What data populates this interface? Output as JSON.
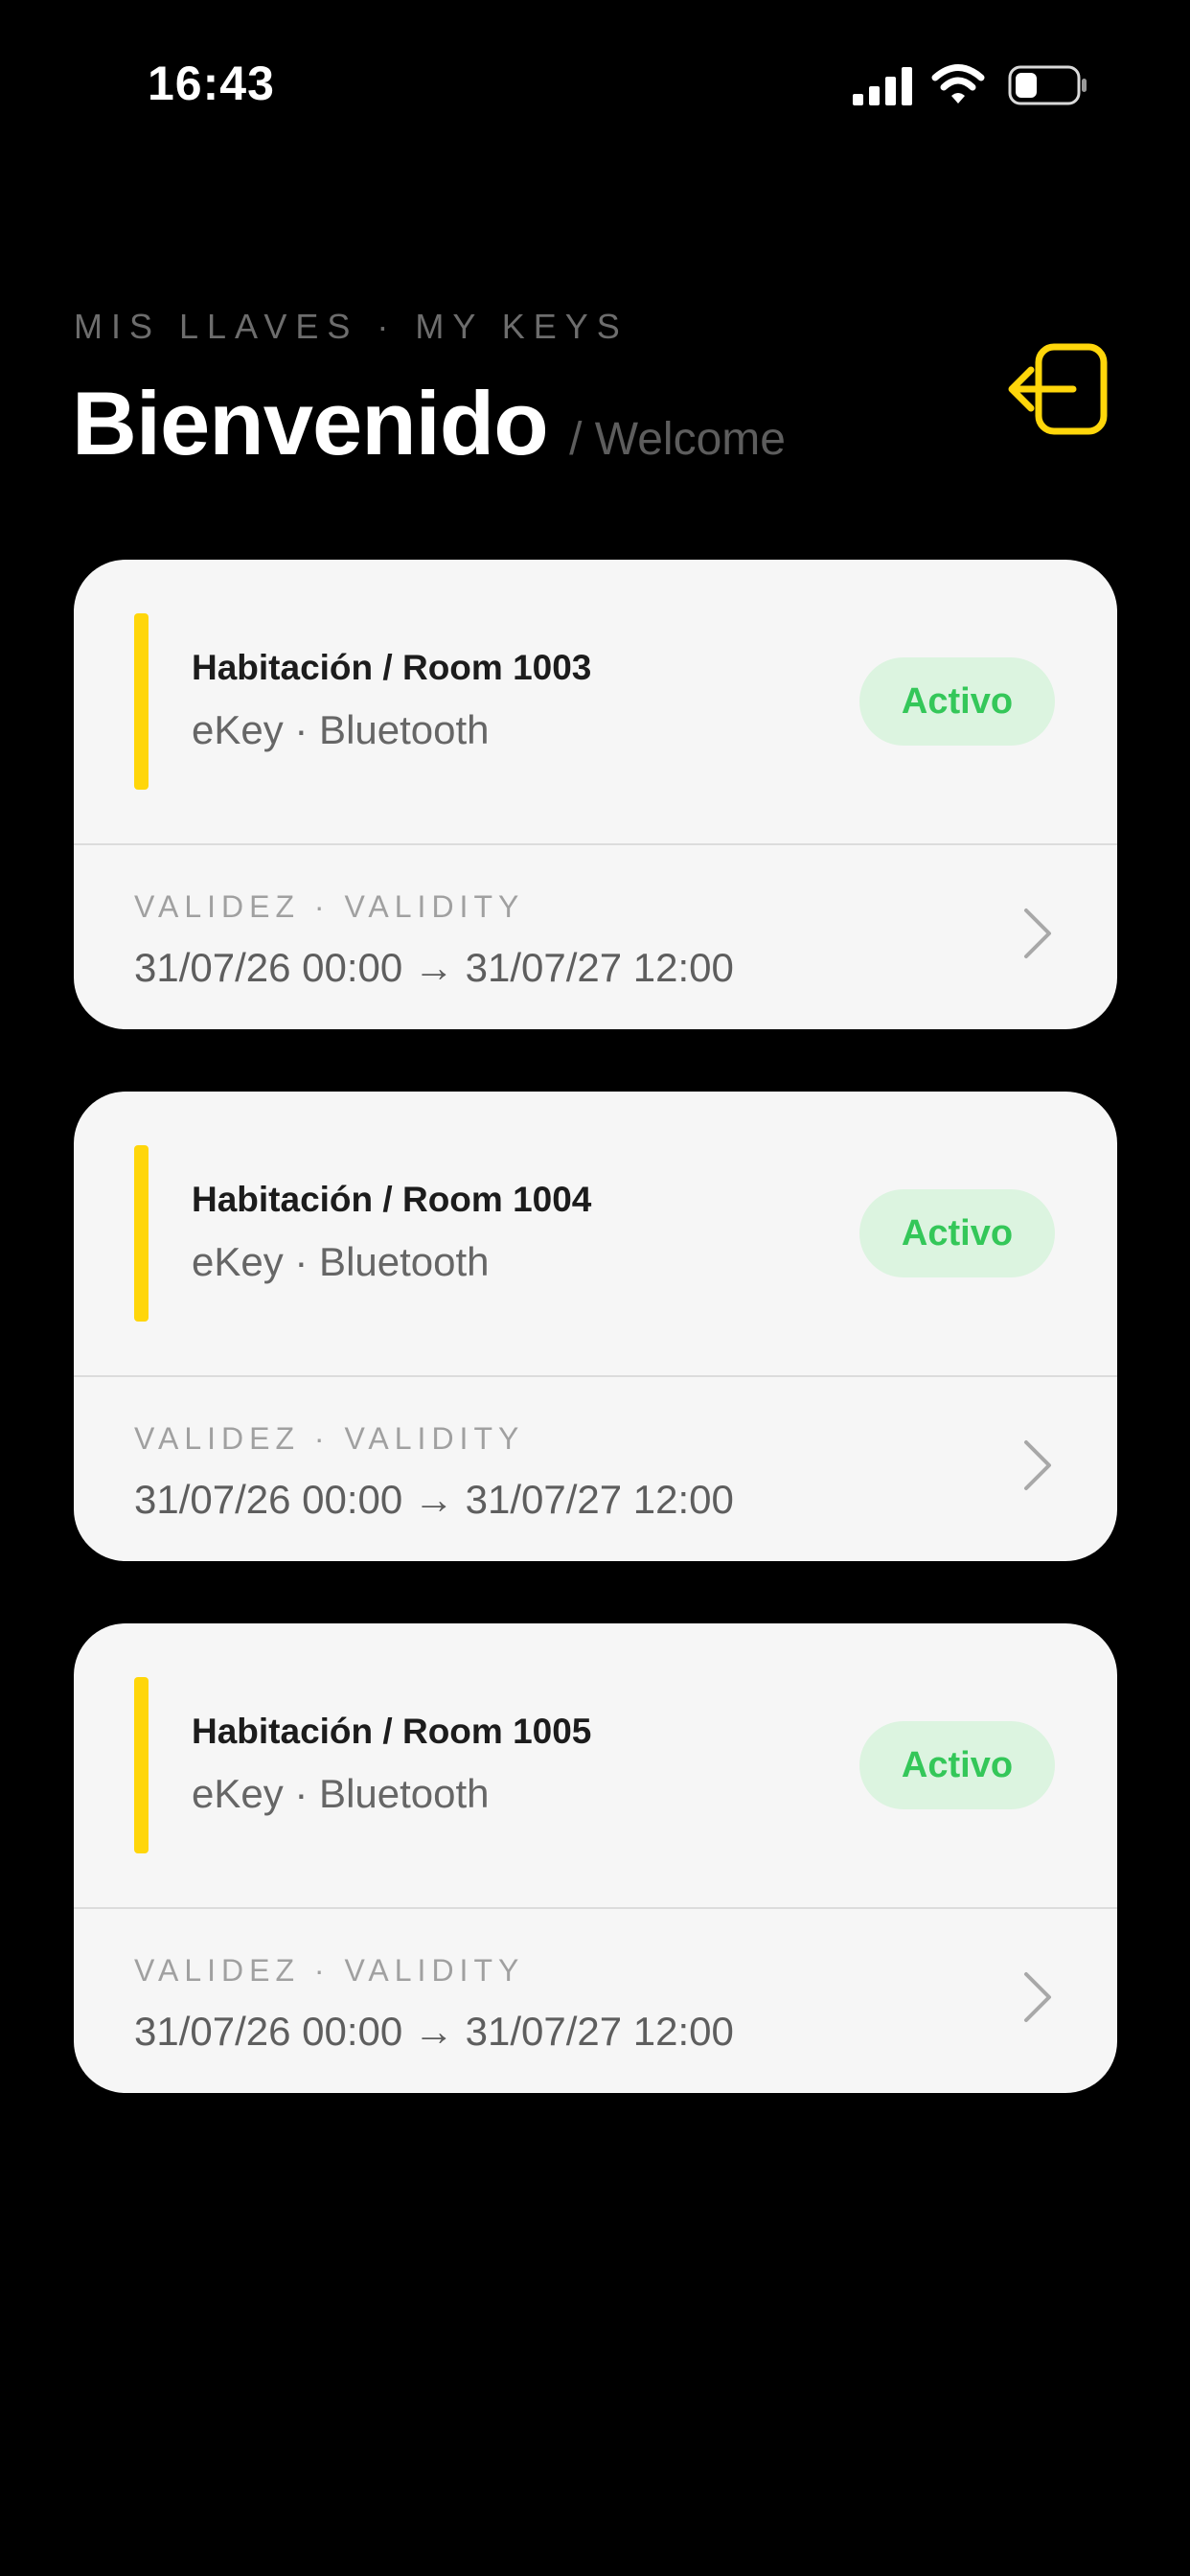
{
  "status_bar": {
    "time": "16:43",
    "icons": [
      "signal-icon",
      "wifi-icon",
      "battery-icon"
    ]
  },
  "header": {
    "overline": "MIS LLAVES · MY KEYS",
    "title": "Bienvenido",
    "subtitle": "/ Welcome",
    "logout_icon": "logout-icon"
  },
  "colors": {
    "background": "#000000",
    "accent": "#FFD60A",
    "card": "#F6F6F6",
    "badge_bg": "#DCF4E0",
    "badge_text": "#34C759"
  },
  "keys": [
    {
      "room": "Habitación / Room 1003",
      "type": "eKey · Bluetooth",
      "status": "Activo",
      "validity_label": "VALIDEZ · VALIDITY",
      "validity": "31/07/26 00:00 → 31/07/27 12:00"
    },
    {
      "room": "Habitación / Room 1004",
      "type": "eKey · Bluetooth",
      "status": "Activo",
      "validity_label": "VALIDEZ · VALIDITY",
      "validity": "31/07/26 00:00 → 31/07/27 12:00"
    },
    {
      "room": "Habitación / Room 1005",
      "type": "eKey · Bluetooth",
      "status": "Activo",
      "validity_label": "VALIDEZ · VALIDITY",
      "validity": "31/07/26 00:00 → 31/07/27 12:00"
    }
  ]
}
